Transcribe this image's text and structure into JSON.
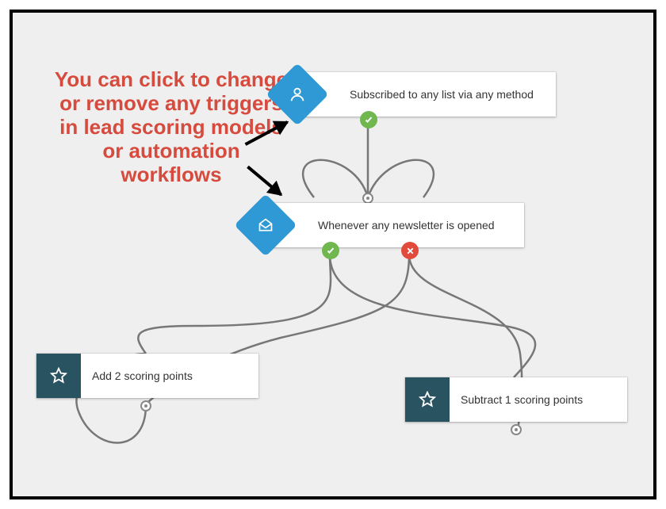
{
  "annotation": {
    "text": "You can click to change or remove any triggers in lead scoring models or automation workflows"
  },
  "colors": {
    "annotation": "#d64b3d",
    "trigger_badge": "#2f99d6",
    "action_badge": "#2a5361",
    "status_ok": "#6fb74e",
    "status_err": "#e24a3b"
  },
  "nodes": {
    "trigger1": {
      "icon": "person-icon",
      "label": "Subscribed to any list via any method",
      "outputs": [
        "ok"
      ]
    },
    "trigger2": {
      "icon": "envelope-open-icon",
      "label": "Whenever any newsletter is opened",
      "outputs": [
        "ok",
        "err"
      ]
    },
    "action1": {
      "icon": "star-icon",
      "label": "Add 2 scoring points"
    },
    "action2": {
      "icon": "star-icon",
      "label": "Subtract 1 scoring points"
    }
  }
}
